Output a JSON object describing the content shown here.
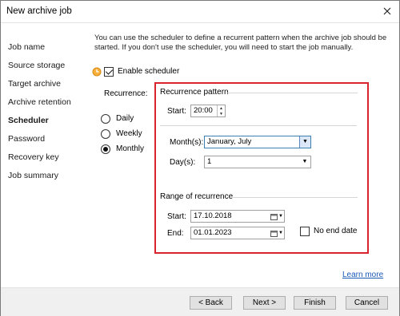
{
  "window": {
    "title": "New archive job"
  },
  "sidebar": {
    "items": [
      {
        "label": "Job name"
      },
      {
        "label": "Source storage"
      },
      {
        "label": "Target archive"
      },
      {
        "label": "Archive retention"
      },
      {
        "label": "Scheduler",
        "active": true
      },
      {
        "label": "Password"
      },
      {
        "label": "Recovery key"
      },
      {
        "label": "Job summary"
      }
    ]
  },
  "content": {
    "info_line1": "You can use the scheduler to define a recurrent pattern when the archive job should be",
    "info_line2": "started. If you don't use the scheduler, you will need to start the job manually.",
    "enable_scheduler_label": "Enable scheduler",
    "enable_scheduler_checked": true,
    "recurrence_label": "Recurrence:",
    "recurrence_options": [
      "Daily",
      "Weekly",
      "Monthly"
    ],
    "recurrence_selected": "Monthly",
    "pattern": {
      "title": "Recurrence pattern",
      "start_label": "Start:",
      "start_value": "20:00",
      "months_label": "Month(s):",
      "months_value": "January, July",
      "days_label": "Day(s):",
      "days_value": "1"
    },
    "range": {
      "title": "Range of recurrence",
      "start_label": "Start:",
      "start_value": "17.10.2018",
      "end_label": "End:",
      "end_value": "01.01.2023",
      "no_end_label": "No end date",
      "no_end_checked": false
    },
    "learn_more": "Learn more",
    "highlight_color": "#d9232f",
    "link_color": "#1a5ab8"
  },
  "footer": {
    "back": "< Back",
    "next": "Next >",
    "finish": "Finish",
    "cancel": "Cancel"
  },
  "icons": {
    "close": "close-icon",
    "scheduler": "clock-icon",
    "calendar": "calendar-icon"
  }
}
